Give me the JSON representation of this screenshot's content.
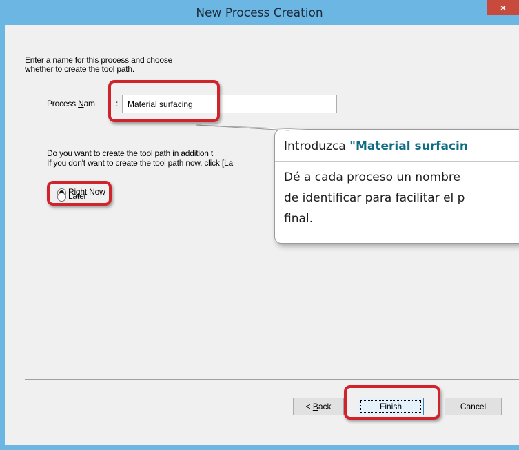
{
  "window": {
    "title": "New Process Creation",
    "close_label": "×"
  },
  "dialog": {
    "intro_line1": "Enter a name for this process and choose",
    "intro_line2": "whether to create the tool path.",
    "process_name_label_pre": "Process ",
    "process_name_label_u": "N",
    "process_name_label_post": "am",
    "process_name_colon": ":",
    "process_name_value": "Material surfacing",
    "question_line1": "Do you want to create the tool path in addition t",
    "question_line2": "If you don't want to create the tool path now, click [La",
    "radio_right_now": "Right Now",
    "radio_later": "Later",
    "selected_option": "Right Now"
  },
  "buttons": {
    "back_pre": "< ",
    "back_u": "B",
    "back_post": "ack",
    "finish": "Finish",
    "cancel": "Cancel"
  },
  "callout": {
    "title_pre": "Introduzca ",
    "title_emphasis": "\"Material surfacin",
    "body_line1": "Dé a cada proceso un nombre",
    "body_line2": "de identificar para facilitar el p",
    "body_line3": "final."
  },
  "colors": {
    "titlebar": "#6cb6e4",
    "close": "#c74a3c",
    "highlight": "#d0242c",
    "callout_emphasis": "#0e6c83"
  }
}
